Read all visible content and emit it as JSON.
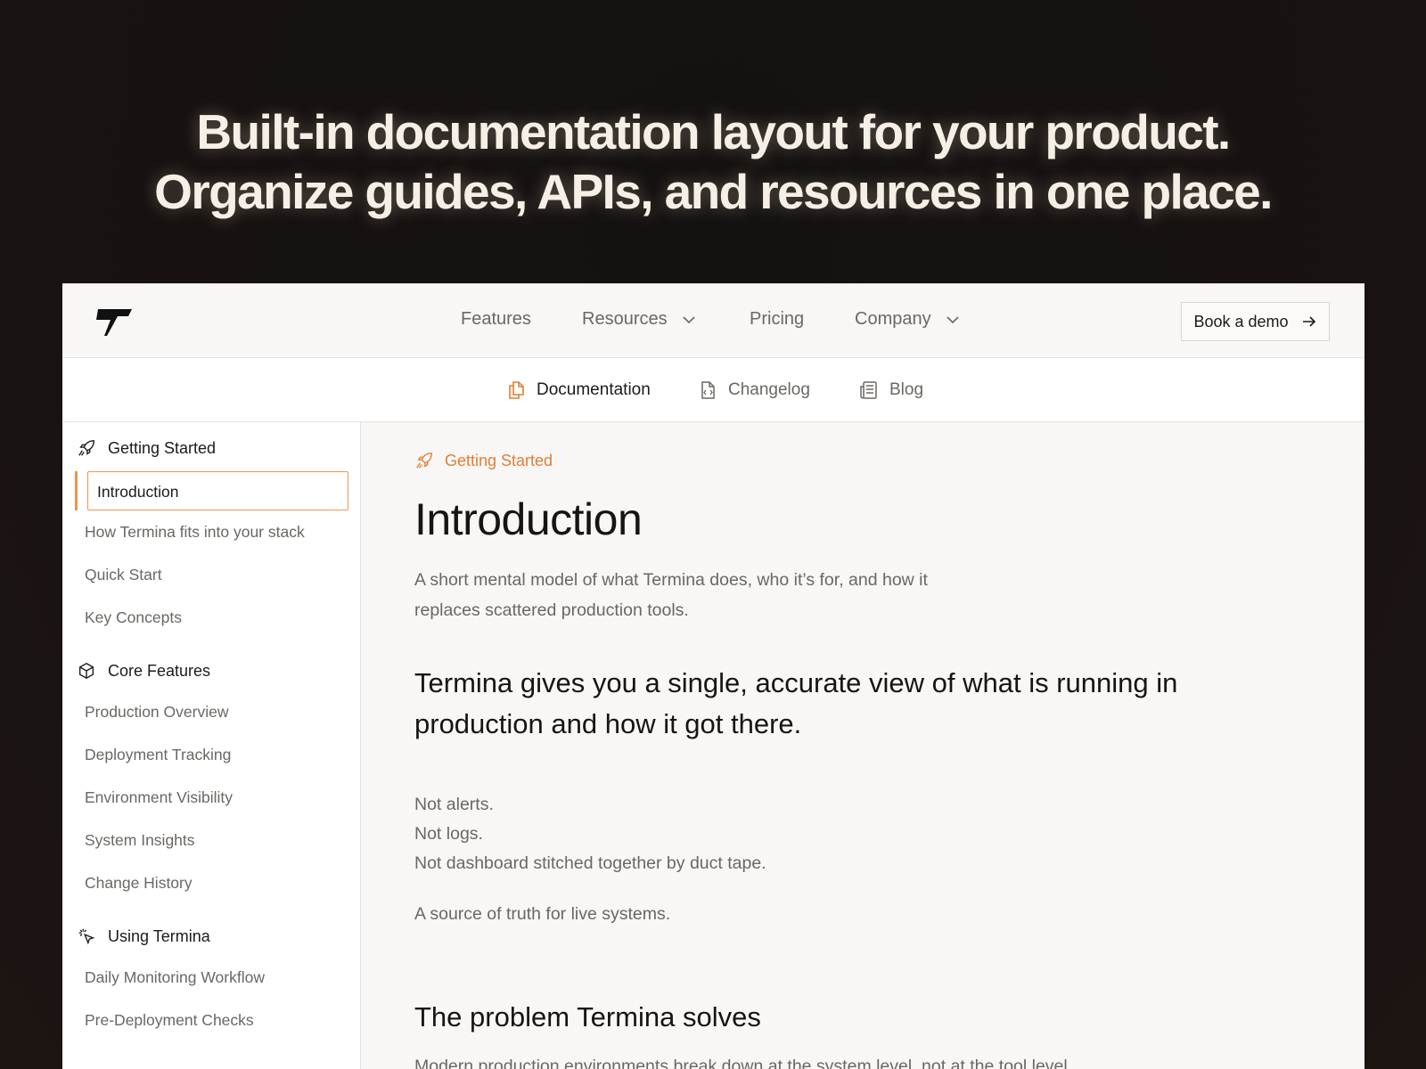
{
  "hero": {
    "line1": "Built-in documentation layout for your product.",
    "line2": "Organize guides, APIs, and resources in one place."
  },
  "topnav": {
    "features": "Features",
    "resources": "Resources",
    "pricing": "Pricing",
    "company": "Company",
    "demo_button": "Book a demo"
  },
  "subnav": {
    "documentation": "Documentation",
    "changelog": "Changelog",
    "blog": "Blog"
  },
  "sidebar": {
    "sections": [
      {
        "label": "Getting Started",
        "icon": "rocket-icon"
      },
      {
        "label": "Core Features",
        "icon": "cube-icon"
      },
      {
        "label": "Using Termina",
        "icon": "cursor-click-icon"
      }
    ],
    "active_item": "Introduction",
    "items": [
      "How Termina fits into your stack",
      "Quick Start",
      "Key Concepts",
      "Production Overview",
      "Deployment Tracking",
      "Environment Visibility",
      "System Insights",
      "Change History",
      "Daily Monitoring Workflow",
      "Pre-Deployment Checks"
    ]
  },
  "main": {
    "breadcrumb": "Getting Started",
    "title": "Introduction",
    "lead": "A short mental model of what Termina does, who it’s for, and how it replaces scattered production tools.",
    "statement": "Termina gives you a single, accurate view of what is running in production and how it got there.",
    "not_alerts": "Not alerts.",
    "not_logs": "Not logs.",
    "not_dashboard": "Not dashboard stitched together by duct tape.",
    "source_of_truth": "A source of truth for live systems.",
    "section_title": "The problem Termina solves",
    "section_text": "Modern production environments break down at the system level, not at the tool level."
  },
  "colors": {
    "accent": "#e07f34",
    "background_dark": "#171211",
    "hero_text": "#f6efe6"
  }
}
